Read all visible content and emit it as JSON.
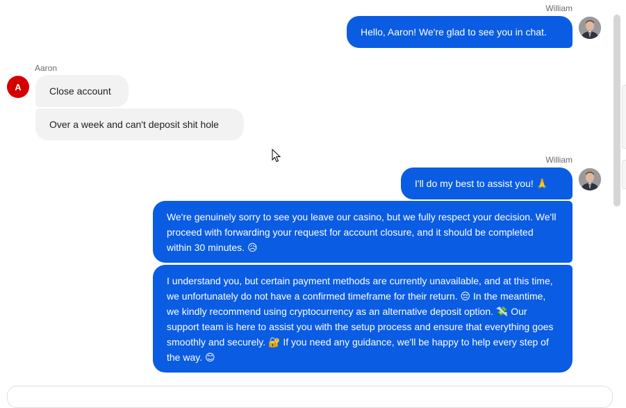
{
  "conversation": {
    "messages": [
      {
        "sender": "William",
        "direction": "out",
        "text": "Hello, Aaron! We're glad to see you in chat."
      },
      {
        "sender": "Aaron",
        "direction": "in",
        "avatar_letter": "A",
        "text": "Close account"
      },
      {
        "sender": "Aaron",
        "direction": "in",
        "text": "Over a week and can't deposit shit hole"
      },
      {
        "sender": "William",
        "direction": "out",
        "text": "I'll do my best to assist you! 🙏"
      },
      {
        "sender": "William",
        "direction": "out",
        "text": "We're genuinely sorry to see you leave our casino, but we fully respect your decision. We'll proceed with forwarding your request for account closure, and it should be completed within 30 minutes. 😥"
      },
      {
        "sender": "William",
        "direction": "out",
        "text": "I understand you, but certain payment methods are currently unavailable, and at this time, we unfortunately do not have a confirmed timeframe for their return. 😔 In the meantime, we kindly recommend using cryptocurrency as an alternative deposit option. 💸 Our support team is here to assist you with the setup process and ensure that everything goes smoothly and securely. 🔐 If you need any guidance, we'll be happy to help every step of the way. 😊"
      }
    ]
  },
  "colors": {
    "agent_bubble": "#0a5ce3",
    "user_bubble": "#f2f2f2",
    "user_avatar": "#d40000"
  },
  "composer": {
    "placeholder": ""
  }
}
